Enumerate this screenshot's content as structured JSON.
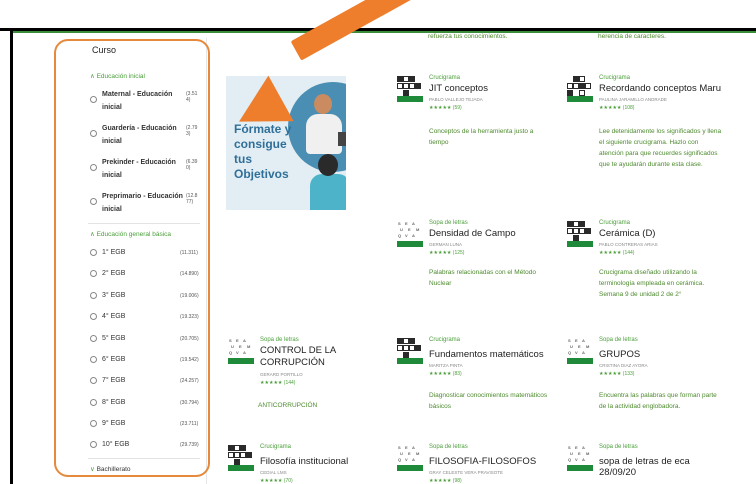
{
  "top_desc": [
    "refuerza tus conocimientos.",
    "herencia de caracteres."
  ],
  "sidebar": {
    "title": "Curso",
    "group1": {
      "label": "Educación inicial",
      "items": [
        {
          "label": "Maternal - Educación inicial",
          "count": "(3.514)"
        },
        {
          "label": "Guardería - Educación inicial",
          "count": "(2.793)"
        },
        {
          "label": "Prekinder - Educación inicial",
          "count": "(6.390)"
        },
        {
          "label": "Preprimario - Educación inicial",
          "count": "(12.877)"
        }
      ]
    },
    "group2": {
      "label": "Educación general básica",
      "items": [
        {
          "label": "1° EGB",
          "count": "(11.311)"
        },
        {
          "label": "2° EGB",
          "count": "(14.890)"
        },
        {
          "label": "3° EGB",
          "count": "(19.006)"
        },
        {
          "label": "4° EGB",
          "count": "(19.323)"
        },
        {
          "label": "5° EGB",
          "count": "(20.705)"
        },
        {
          "label": "6° EGB",
          "count": "(19.542)"
        },
        {
          "label": "7° EGB",
          "count": "(24.257)"
        },
        {
          "label": "8° EGB",
          "count": "(30.794)"
        },
        {
          "label": "9° EGB",
          "count": "(23.711)"
        },
        {
          "label": "10° EGB",
          "count": "(29.739)"
        }
      ]
    },
    "group3": {
      "label": "Bachillerato"
    }
  },
  "banner": {
    "text": "Fórmate y consigue tus Objetivos"
  },
  "cards": [
    {
      "type": "Crucigrama",
      "title": "JIT conceptos",
      "author": "PABLO VALLEJO TEJADA",
      "rating": "★★★★★ (59)",
      "desc": "Conceptos de la herramienta justo a tiempo",
      "kind": "cw"
    },
    {
      "type": "Crucigrama",
      "title": "Recordando conceptos Maru",
      "author": "PAULINA JARAMILLO ANDRADE",
      "rating": "★★★★★ (108)",
      "desc": "Lee detenidamente los significados y llena el siguiente crucigrama. Hazlo con atención para que recuerdes significados que te ayudarán durante esta clase.",
      "kind": "cw"
    },
    {
      "type": "Sopa de letras",
      "title": "Densidad de Campo",
      "author": "GERMAN LUNA",
      "rating": "★★★★★ (125)",
      "desc": "Palabras relacionadas con el Método Nuclear",
      "kind": "ws"
    },
    {
      "type": "Crucigrama",
      "title": "Cerámica (D)",
      "author": "PABLO CONTRERAS ARIAS",
      "rating": "★★★★★ (144)",
      "desc": "Crucigrama diseñado utilizando la terminología empleada en cerámica. Semana 9 de unidad 2 de 2°",
      "kind": "cw"
    },
    {
      "type": "Sopa de letras",
      "title": "CONTROL DE LA CORRUPCIÓN",
      "author": "GERARD PORTILLO",
      "rating": "★★★★★ (144)",
      "desc": "ANTICORRUPCIÓN",
      "kind": "ws"
    },
    {
      "type": "Crucigrama",
      "title": "Fundamentos matemáticos",
      "author": "MARITZA PINTA",
      "rating": "★★★★★ (83)",
      "desc": "Diagnosticar conocimientos matemáticos básicos",
      "kind": "cw"
    },
    {
      "type": "Sopa de letras",
      "title": "GRUPOS",
      "author": "CRISTINA DIAZ AYORA",
      "rating": "★★★★★ (133)",
      "desc": "Encuentra las palabras que forman parte de la actividad englobadora.",
      "kind": "ws"
    },
    {
      "type": "Crucigrama",
      "title": "Filosofía institucional",
      "author": "CEDIAL LMS",
      "rating": "★★★★★ (70)",
      "desc": "",
      "kind": "cw"
    },
    {
      "type": "Sopa de letras",
      "title": "FILOSOFIA-FILOSOFOS",
      "author": "GRAY CELESTE VERA PRAVISOTE",
      "rating": "★★★★★ (98)",
      "desc": "",
      "kind": "ws"
    },
    {
      "type": "Sopa de letras",
      "title": "sopa de letras de eca 28/09/20",
      "author": "",
      "rating": "",
      "desc": "",
      "kind": "ws"
    }
  ],
  "colors": {
    "accent": "#4a9e3a",
    "annotation": "#ee7d2c"
  }
}
